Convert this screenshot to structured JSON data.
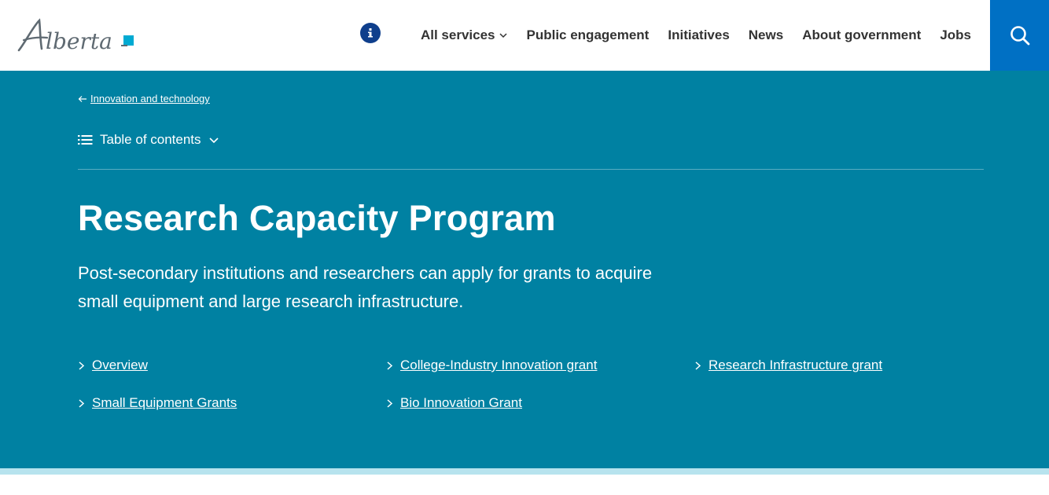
{
  "header": {
    "logo_text": "Alberta",
    "info_label": "i",
    "nav": [
      {
        "label": "All services",
        "has_dropdown": true
      },
      {
        "label": "Public engagement"
      },
      {
        "label": "Initiatives"
      },
      {
        "label": "News"
      },
      {
        "label": "About government"
      },
      {
        "label": "Jobs"
      }
    ],
    "search_icon": "search-icon"
  },
  "hero": {
    "breadcrumb": "Innovation and technology",
    "toc_label": "Table of contents",
    "title": "Research Capacity Program",
    "lead": "Post-secondary institutions and researchers can apply for grants to acquire small equipment and large research infrastructure.",
    "links": [
      {
        "label": "Overview"
      },
      {
        "label": "College-Industry Innovation grant"
      },
      {
        "label": "Research Infrastructure grant"
      },
      {
        "label": "Small Equipment Grants"
      },
      {
        "label": "Bio Innovation Grant"
      }
    ]
  },
  "colors": {
    "hero_bg": "#0081a2",
    "search_bg": "#0070c4",
    "info_bg": "#0f3f8c",
    "strip": "#b7e3ee",
    "logo_accent": "#00aad2"
  }
}
